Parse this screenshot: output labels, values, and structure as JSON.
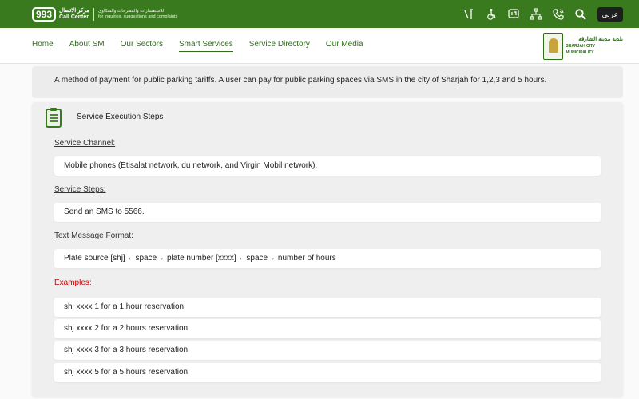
{
  "topbar": {
    "call_center_number": "993",
    "call_center_ar": "مركز الاتصال",
    "call_center_en": "Call Center",
    "call_center_desc_ar": "للاستفسارات والمقترحات والشكاوى",
    "call_center_desc_en": "for inquiries, suggestions and complaints",
    "icons": [
      "accessibility-icon",
      "wheelchair-icon",
      "sign-language-icon",
      "sitemap-icon",
      "phone-icon",
      "search-icon"
    ],
    "lang_label": "عربي"
  },
  "nav": {
    "items": [
      {
        "label": "Home"
      },
      {
        "label": "About SM"
      },
      {
        "label": "Our Sectors"
      },
      {
        "label": "Smart Services"
      },
      {
        "label": "Service Directory"
      },
      {
        "label": "Our Media"
      }
    ],
    "active": "Smart Services"
  },
  "logo": {
    "ar": "بلدية مدينة الشارقة",
    "en": "SHARJAH CITY MUNICIPALITY"
  },
  "intro": "A method of payment for public parking tariffs. A user can pay for public parking spaces via SMS in the city of Sharjah for 1,2,3 and 5 hours.",
  "steps": {
    "title": "Service Execution Steps",
    "channel_label": "Service Channel:",
    "channel_value": "Mobile phones (Etisalat network, du network, and Virgin Mobil network).",
    "steps_label": "Service Steps:",
    "steps_value": "Send an SMS to 5566.",
    "format_label": "Text Message Format:",
    "format_value": "Plate source [shj] ←space→ plate number [xxxx] ←space→ number of hours",
    "examples_label": "Examples:",
    "examples": [
      "shj xxxx 1  for a 1 hour reservation",
      "shj xxxx 2  for a 2 hours reservation",
      "shj xxxx 3  for a 3 hours reservation",
      "shj xxxx 5  for a 5 hours reservation"
    ]
  },
  "colors": {
    "brand_green": "#3a7a1e",
    "nav_green": "#2f6f1a",
    "examples_red": "#cc0000"
  }
}
